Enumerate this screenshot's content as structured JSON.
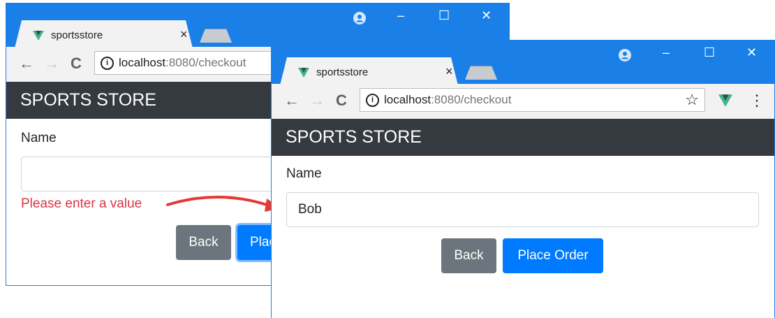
{
  "window_left": {
    "tab_title": "sportsstore",
    "url_host": "localhost",
    "url_path": ":8080/checkout",
    "brand": "SPORTS STORE",
    "name_label": "Name",
    "name_value": "",
    "error": "Please enter a value",
    "back_label": "Back",
    "place_order_label": "Plac"
  },
  "window_right": {
    "tab_title": "sportsstore",
    "url_host": "localhost",
    "url_path": ":8080/checkout",
    "brand": "SPORTS STORE",
    "name_label": "Name",
    "name_value": "Bob",
    "back_label": "Back",
    "place_order_label": "Place Order"
  },
  "icons": {
    "tab_close": "×",
    "back": "←",
    "forward": "→",
    "reload": "C",
    "minimize": "–",
    "maximize": "☐",
    "close": "✕",
    "bookmark": "☆",
    "menu": "⋮"
  },
  "colors": {
    "titlebar": "#1a80e8",
    "navbar": "#343a40",
    "primary": "#007bff",
    "secondary": "#6c757d",
    "danger": "#dc3545",
    "vue": "#41b883",
    "arrow": "#e53935"
  }
}
